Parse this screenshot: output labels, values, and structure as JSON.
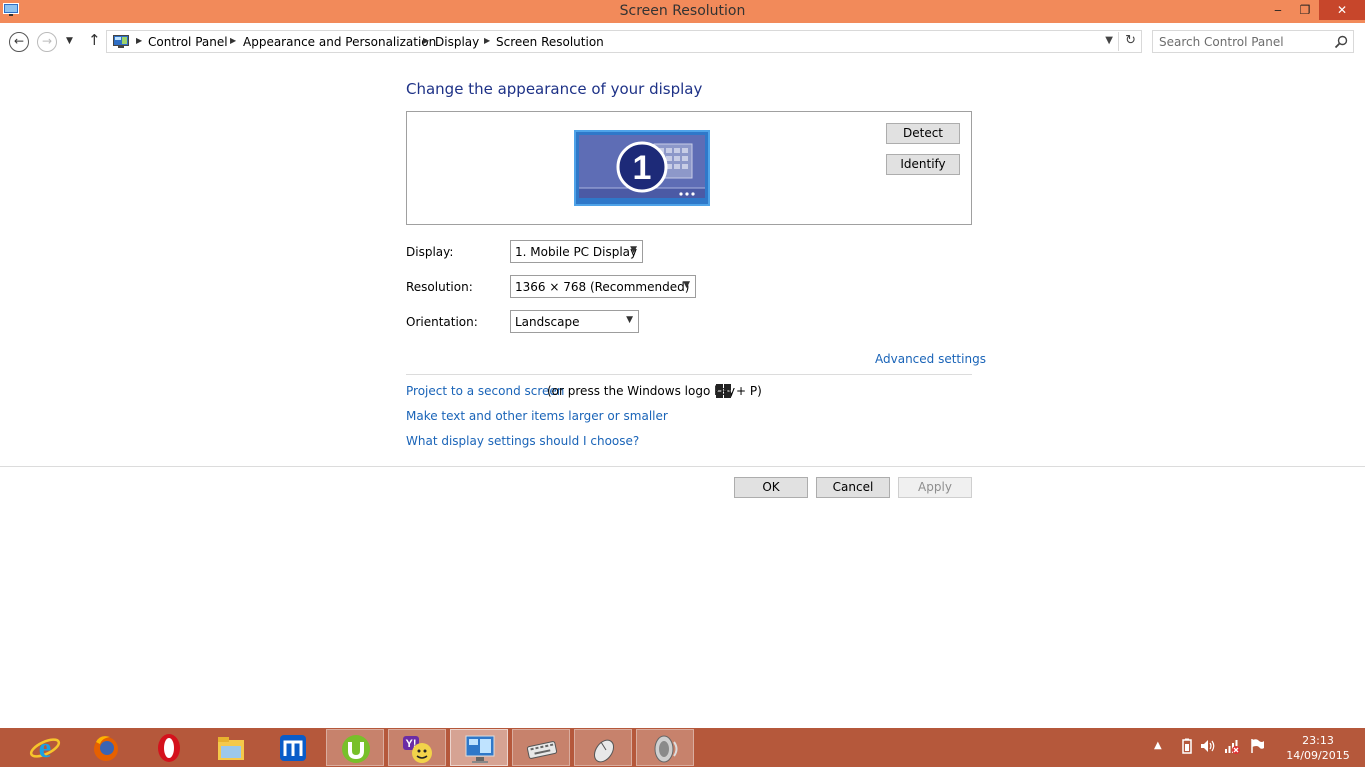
{
  "window": {
    "title": "Screen Resolution",
    "app_icon": "display-icon",
    "controls": {
      "minimize": "‒",
      "maximize": "❐",
      "close": "✕"
    }
  },
  "navigation": {
    "back_icon": "arrow-left-icon",
    "forward_icon": "arrow-right-icon",
    "recent_icon": "chevron-down-icon",
    "up_icon": "arrow-up-icon",
    "breadcrumbs": [
      "Control Panel",
      "Appearance and Personalization",
      "Display",
      "Screen Resolution"
    ],
    "refresh_icon": "refresh-icon"
  },
  "search": {
    "placeholder": "Search Control Panel",
    "icon": "search-icon"
  },
  "main": {
    "heading": "Change the appearance of your display",
    "monitor_number": "1",
    "detect_label": "Detect",
    "identify_label": "Identify",
    "display_label": "Display:",
    "display_value": "1. Mobile PC Display",
    "resolution_label": "Resolution:",
    "resolution_value": "1366 × 768 (Recommended)",
    "orientation_label": "Orientation:",
    "orientation_value": "Landscape",
    "advanced_link": "Advanced settings",
    "project_link": "Project to a second screen",
    "project_suffix_before": "(or press the Windows logo key",
    "project_suffix_after": "+ P)",
    "text_size_link": "Make text and other items larger or smaller",
    "help_link": "What display settings should I choose?"
  },
  "footer": {
    "ok_label": "OK",
    "cancel_label": "Cancel",
    "apply_label": "Apply"
  },
  "taskbar": {
    "apps": [
      "internet-explorer-icon",
      "firefox-icon",
      "opera-icon",
      "file-explorer-icon",
      "maxthon-icon",
      "utorrent-icon",
      "yahoo-messenger-icon",
      "screen-resolution-icon",
      "keyboard-icon",
      "mouse-icon",
      "speaker-icon"
    ],
    "time": "23:13",
    "date": "14/09/2015"
  },
  "colors": {
    "titlebar": "#f28a5a",
    "taskbar": "#b5583b",
    "link": "#1a64b8",
    "heading": "#1e3287",
    "close_button": "#c7462b"
  }
}
